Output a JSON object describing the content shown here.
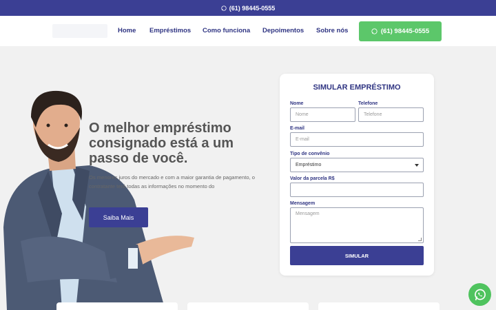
{
  "topbar": {
    "phone": "(61) 98445-0555",
    "icon": "whatsapp-icon"
  },
  "nav": {
    "items": [
      {
        "label": "Home"
      },
      {
        "label": "Empréstimos"
      },
      {
        "label": "Como funciona"
      },
      {
        "label": "Depoimentos"
      },
      {
        "label": "Sobre nós"
      }
    ],
    "cta_label": "(61) 98445-0555",
    "cta_icon": "whatsapp-icon"
  },
  "hero": {
    "headline": "O melhor empréstimo consignado está a um passo de você.",
    "subtext": "Os menores juros do mercado e com a maior garantia de pagamento, o contratante terá todas as informações no momento do",
    "button_label": "Saiba Mais"
  },
  "form": {
    "title": "SIMULAR EMPRÉSTIMO",
    "nome_label": "Nome",
    "nome_placeholder": "Nome",
    "telefone_label": "Telefone",
    "telefone_placeholder": "Telefone",
    "email_label": "E-mail",
    "email_placeholder": "E-mail",
    "convenio_label": "Tipo de convênio",
    "convenio_value": "Empréstimo",
    "parcela_label": "Valor da parcela R$",
    "parcela_value": "",
    "mensagem_label": "Mensagem",
    "mensagem_placeholder": "Mensagem",
    "submit_label": "SIMULAR"
  },
  "colors": {
    "brand": "#3b3f94",
    "whatsapp": "#5cc76a",
    "background": "#f1f1f1"
  }
}
